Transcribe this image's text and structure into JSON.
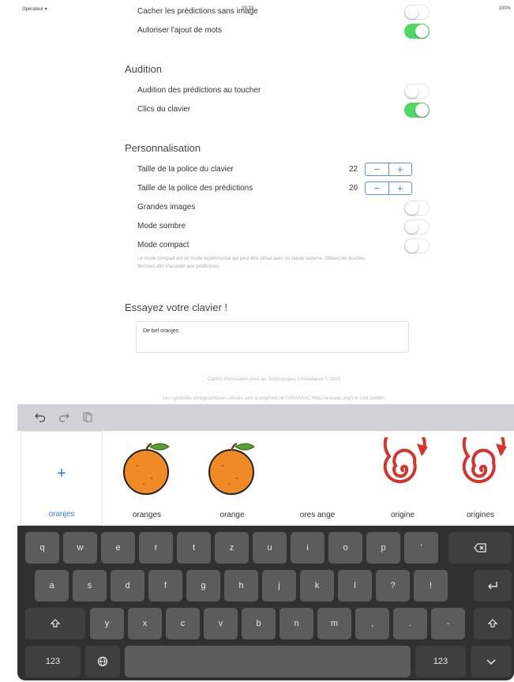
{
  "status_bar": {
    "carrier": "Opérateur ⁠▾",
    "time": "09:33",
    "battery": "100%"
  },
  "settings": {
    "rows_top": [
      {
        "label": "Cacher les prédictions sans image",
        "on": false
      },
      {
        "label": "Autoriser l'ajout de mots",
        "on": true
      }
    ],
    "audition": {
      "title": "Audition",
      "rows": [
        {
          "label": "Audition des prédictions au toucher",
          "on": false
        },
        {
          "label": "Clics du clavier",
          "on": true
        }
      ]
    },
    "personnalisation": {
      "title": "Personnalisation",
      "font_keyboard": {
        "label": "Taille de la police du clavier",
        "value": "22"
      },
      "font_predictions": {
        "label": "Taille de la police des prédictions",
        "value": "20"
      },
      "stepper_minus": "−",
      "stepper_plus": "+",
      "rows": [
        {
          "label": "Grandes images",
          "on": false
        },
        {
          "label": "Mode sombre",
          "on": false
        },
        {
          "label": "Mode compact",
          "on": false
        }
      ],
      "note": "Le mode compact est un mode expérimental qui peut être utilisé avec un clavier externe. Utilisez les touches flèchées afin d'accéder aux prédictions."
    }
  },
  "try": {
    "title": "Essayez votre clavier !",
    "text": "De bel oranjes"
  },
  "footer": {
    "line1": "Centre d'Innovation pour les Technologies d'Assistance © 2018",
    "line2": "Les symboles pictographiques utilisés sont la propriété de l'ARASAAC (http://arasaac.org/) et sont publiés"
  },
  "toolbar": {
    "undo_icon": "undo-icon",
    "redo_icon": "redo-icon",
    "paste_icon": "paste-icon"
  },
  "predictions": {
    "add_icon": "+",
    "items": [
      {
        "label": "oranjes",
        "icon": "plus-icon"
      },
      {
        "label": "oranges",
        "icon": "orange-icon"
      },
      {
        "label": "orange",
        "icon": "orange-icon"
      },
      {
        "label": "ores ange",
        "icon": ""
      },
      {
        "label": "origine",
        "icon": "spiral-icon"
      },
      {
        "label": "origines",
        "icon": "spiral-icon"
      }
    ],
    "colors": {
      "orange": "#f08a24",
      "leaf": "#5a9e2f",
      "spiral": "#d9312c"
    }
  },
  "keyboard": {
    "row1": [
      "q",
      "w",
      "e",
      "r",
      "t",
      "z",
      "u",
      "i",
      "o",
      "p",
      "'"
    ],
    "row2": [
      "a",
      "s",
      "d",
      "f",
      "g",
      "h",
      "j",
      "k",
      "l",
      "?",
      "!"
    ],
    "row3": [
      "y",
      "x",
      "c",
      "v",
      "b",
      "n",
      "m",
      ",",
      ".",
      "-"
    ],
    "numbers_label": "123",
    "backspace_icon": "backspace-icon",
    "return_icon": "return-icon",
    "shift_icon": "shift-icon",
    "globe_icon": "globe-icon",
    "dismiss_icon": "keyboard-dismiss-icon"
  }
}
